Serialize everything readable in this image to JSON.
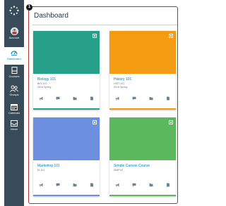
{
  "page": {
    "title": "Dashboard",
    "step_number": "1"
  },
  "nav": {
    "items": [
      {
        "label": "Account",
        "icon": "avatar",
        "active": false
      },
      {
        "label": "Dashboard",
        "icon": "dashboard-icon",
        "active": true
      },
      {
        "label": "Courses",
        "icon": "courses-icon",
        "active": false
      },
      {
        "label": "Groups",
        "icon": "groups-icon",
        "active": false
      },
      {
        "label": "Calendar",
        "icon": "calendar-icon",
        "active": false
      },
      {
        "label": "Inbox",
        "icon": "inbox-icon",
        "active": false
      }
    ]
  },
  "cards": [
    {
      "name": "Biology 101",
      "code": "BIO-101",
      "term": "2016 Spring",
      "color": "#27a08a"
    },
    {
      "name": "History 101",
      "code": "HIST-101",
      "term": "2016 Spring",
      "color": "#f39c12"
    },
    {
      "name": "Marketing 101",
      "code": "M-101",
      "term": "",
      "color": "#6d8fe0"
    },
    {
      "name": "Simple Canvas Course",
      "code": "SIMPLE",
      "term": "",
      "color": "#5cb85c"
    }
  ],
  "card_icons": [
    "announcements-icon",
    "discussions-icon",
    "files-icon",
    "assignments-icon"
  ],
  "colors": {
    "nav_bg": "#394b58",
    "link": "#0081c6",
    "highlight": "#b3312f"
  }
}
